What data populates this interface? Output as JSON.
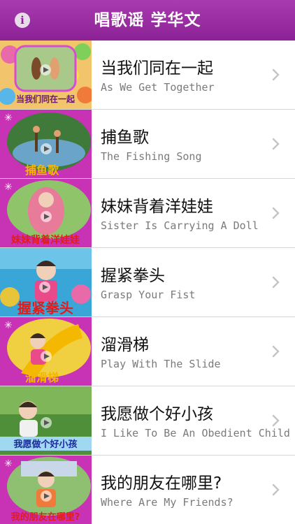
{
  "header": {
    "title": "唱歌谣 学华文",
    "info_icon": "info-icon",
    "info_glyph": "i",
    "background": "#9c2ba3"
  },
  "songs": [
    {
      "title_cn": "当我们同在一起",
      "title_en": "As We Get Together",
      "thumb_caption": "当我们同在一起",
      "thumb_caption_color": "#6a1a6e",
      "thumb_bg": "#f2c46b"
    },
    {
      "title_cn": "捕鱼歌",
      "title_en": "The Fishing Song",
      "thumb_caption": "捕鱼歌",
      "thumb_caption_color": "#f4b800",
      "thumb_bg": "#c832b4"
    },
    {
      "title_cn": "妹妹背着洋娃娃",
      "title_en": "Sister Is Carrying A Doll",
      "thumb_caption": "妹妹背着洋娃娃",
      "thumb_caption_color": "#e01c1c",
      "thumb_bg": "#c832b4"
    },
    {
      "title_cn": "握紧拳头",
      "title_en": "Grasp Your Fist",
      "thumb_caption": "握紧拳头",
      "thumb_caption_color": "#e01c1c",
      "thumb_bg": "#3aa6d8"
    },
    {
      "title_cn": "溜滑梯",
      "title_en": "Play With The Slide",
      "thumb_caption": "溜滑梯",
      "thumb_caption_color": "#f4b800",
      "thumb_bg": "#c832b4"
    },
    {
      "title_cn": "我愿做个好小孩",
      "title_en": "I Like To Be An Obedient Child",
      "thumb_caption": "我愿做个好小孩",
      "thumb_caption_color": "#1a2a9a",
      "thumb_bg": "#4f8f3a"
    },
    {
      "title_cn": "我的朋友在哪里?",
      "title_en": "Where Are My Friends?",
      "thumb_caption": "我的朋友在哪里?",
      "thumb_caption_color": "#e01c1c",
      "thumb_bg": "#c832b4"
    }
  ]
}
